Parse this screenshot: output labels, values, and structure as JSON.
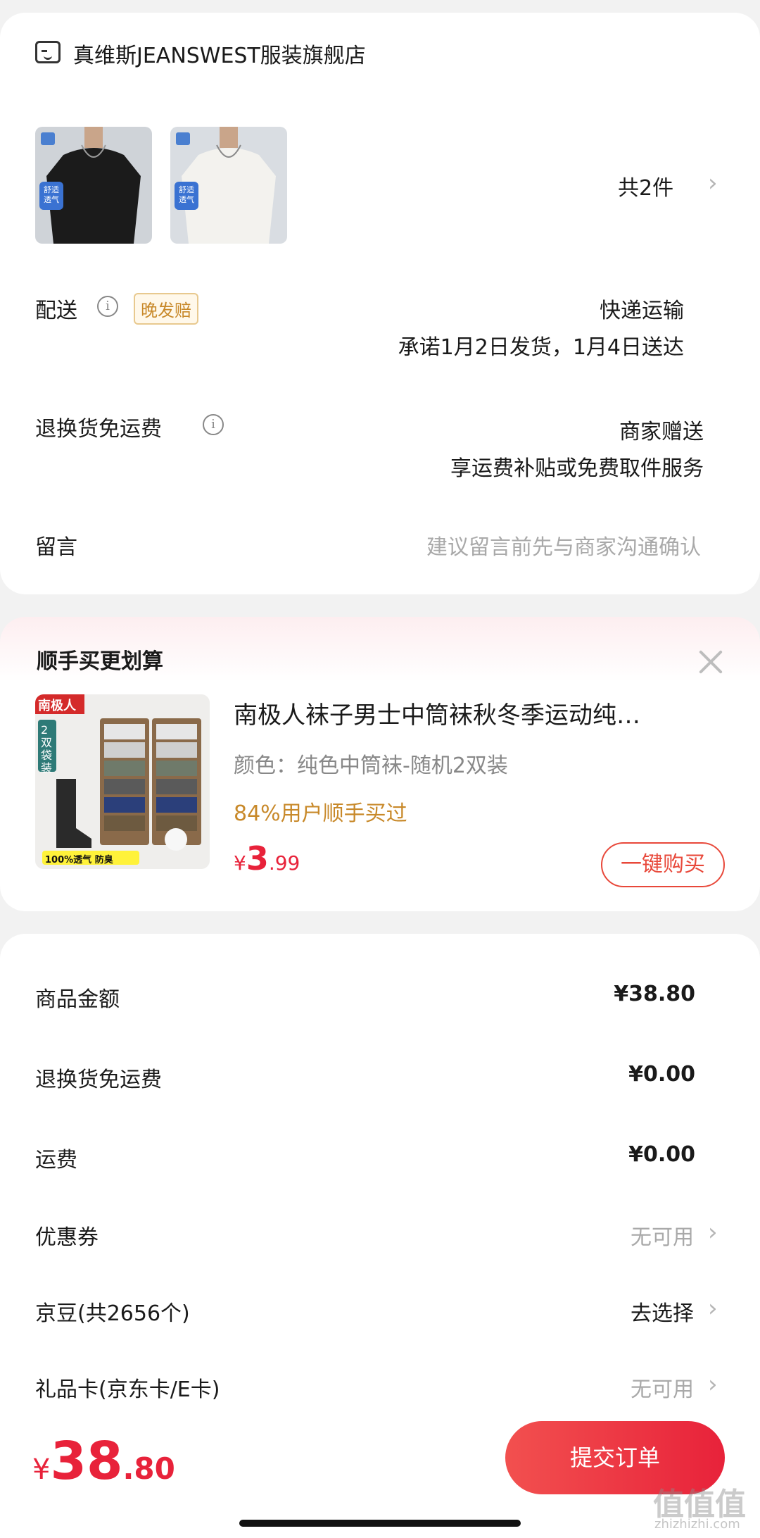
{
  "store": {
    "name": "真维斯JEANSWEST服装旗舰店",
    "item_count": "共2件",
    "thumb_badge": "舒适\n透气",
    "delivery": {
      "label": "配送",
      "badge": "晚发赔",
      "method": "快递运输",
      "promise": "承诺1月2日发货，1月4日送达"
    },
    "return_shipping": {
      "label": "退换货免运费",
      "value": "商家赠送",
      "desc": "享运费补贴或免费取件服务"
    },
    "message": {
      "label": "留言",
      "placeholder": "建议留言前先与商家沟通确认"
    }
  },
  "upsell": {
    "title": "顺手买更划算",
    "product_name": "南极人袜子男士中筒袜秋冬季运动纯…",
    "spec": "颜色：纯色中筒袜-随机2双装",
    "stat": "84%用户顺手买过",
    "price_symbol": "¥",
    "price_int": "3",
    "price_dec": ".99",
    "buy_label": "一键购买",
    "img_brand": "南极人",
    "img_side": "2双袋装",
    "img_strip": "100%透气 防臭"
  },
  "summary": {
    "rows": [
      {
        "label": "商品金额",
        "value": "¥38.80"
      },
      {
        "label": "退换货免运费",
        "value": "¥0.00"
      },
      {
        "label": "运费",
        "value": "¥0.00"
      },
      {
        "label": "优惠券",
        "value": "无可用"
      },
      {
        "label": "京豆(共2656个)",
        "value": "去选择"
      },
      {
        "label": "礼品卡(京东卡/E卡)",
        "value": "无可用"
      }
    ]
  },
  "bottom": {
    "price_symbol": "¥",
    "price_int": "38",
    "price_dec": ".80",
    "submit_label": "提交订单"
  },
  "watermark": {
    "text": "值值值",
    "url": "zhizhizhi.com"
  },
  "colors": {
    "accent": "#e8223a",
    "orange": "#c8892a"
  }
}
